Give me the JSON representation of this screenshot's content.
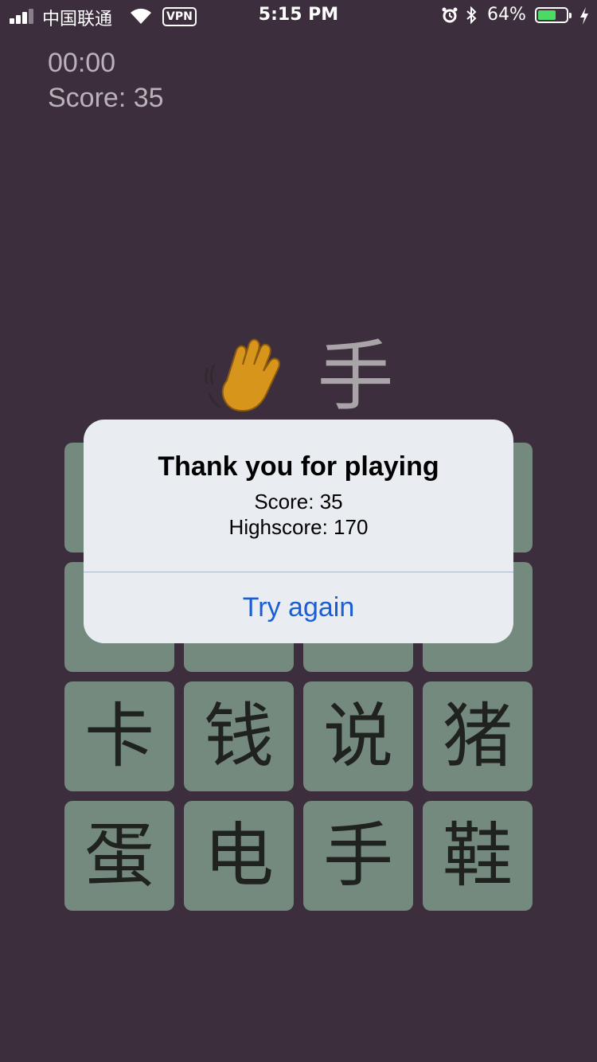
{
  "status_bar": {
    "carrier": "中国联通",
    "vpn_label": "VPN",
    "time": "5:15 PM",
    "battery_percent": "64%",
    "battery_level": 0.64,
    "battery_color": "#4cd964",
    "icons": [
      "signal-icon",
      "wifi-icon",
      "alarm-icon",
      "bluetooth-icon",
      "battery-icon",
      "charging-icon"
    ]
  },
  "game": {
    "timer": "00:00",
    "score_label": "Score: 35",
    "prompt_emoji": "waving-hand-icon",
    "prompt_char": "手",
    "tiles": [
      "",
      "",
      "",
      "",
      "",
      "",
      "",
      "",
      "卡",
      "钱",
      "说",
      "猪",
      "蛋",
      "电",
      "手",
      "鞋"
    ]
  },
  "alert": {
    "title": "Thank you for playing",
    "score_line": "Score: 35",
    "highscore_line": "Highscore: 170",
    "button_label": "Try again",
    "button_color": "#1a5ed6"
  },
  "colors": {
    "background": "#3c2e3c",
    "tile": "#748a7e",
    "alert_bg": "#e9edf1"
  }
}
